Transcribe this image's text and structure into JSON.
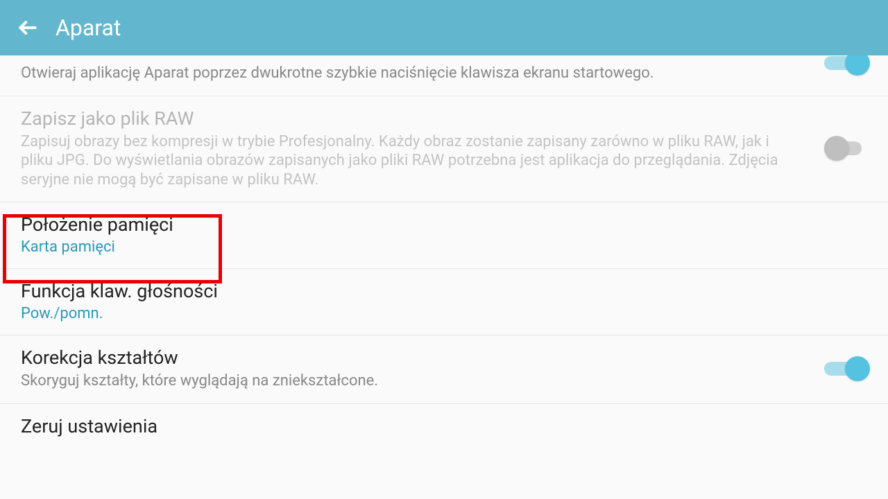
{
  "header": {
    "title": "Aparat"
  },
  "rows": {
    "quicklaunch": {
      "desc": "Otwieraj aplikację Aparat poprzez dwukrotne szybkie naciśnięcie klawisza ekranu startowego."
    },
    "raw": {
      "title": "Zapisz jako plik RAW",
      "desc": "Zapisuj obrazy bez kompresji w trybie Profesjonalny. Każdy obraz zostanie zapisany zarówno w pliku RAW, jak i pliku JPG. Do wyświetlania obrazów zapisanych jako pliki RAW potrzebna jest aplikacja do przeglądania. Zdjęcia seryjne nie mogą być zapisane w pliku RAW."
    },
    "storage": {
      "title": "Położenie pamięci",
      "value": "Karta pamięci"
    },
    "volkey": {
      "title": "Funkcja klaw. głośności",
      "value": "Pow./pomn."
    },
    "shape": {
      "title": "Korekcja kształtów",
      "desc": "Skoryguj kształty, które wyglądają na zniekształcone."
    },
    "reset": {
      "title": "Zeruj ustawienia"
    }
  }
}
